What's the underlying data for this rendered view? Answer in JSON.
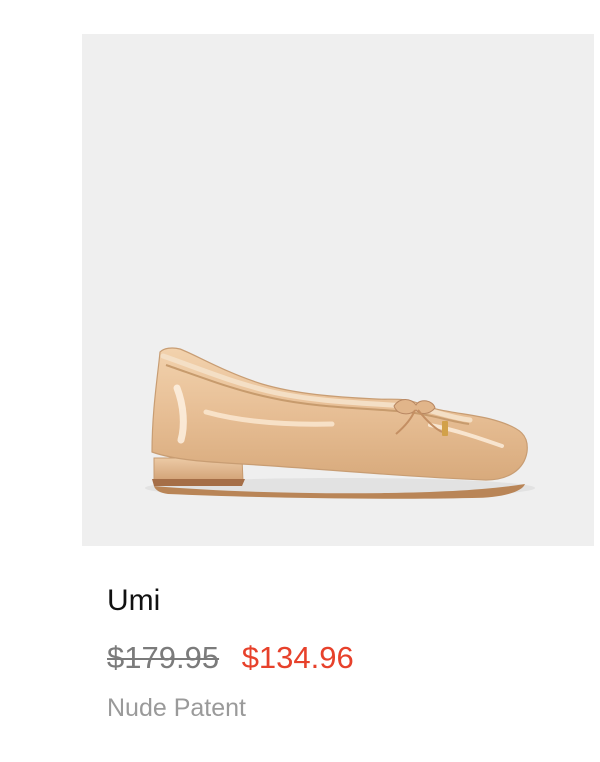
{
  "product": {
    "name": "Umi",
    "original_price": "$179.95",
    "sale_price": "$134.96",
    "color": "Nude Patent",
    "image_icon": "ballet-flat-shoe-icon"
  },
  "colors": {
    "image_background": "#efefef",
    "name_text": "#111111",
    "original_price_text": "#7b7b7b",
    "sale_price_text": "#e7412b",
    "color_text": "#9a9a9a"
  }
}
